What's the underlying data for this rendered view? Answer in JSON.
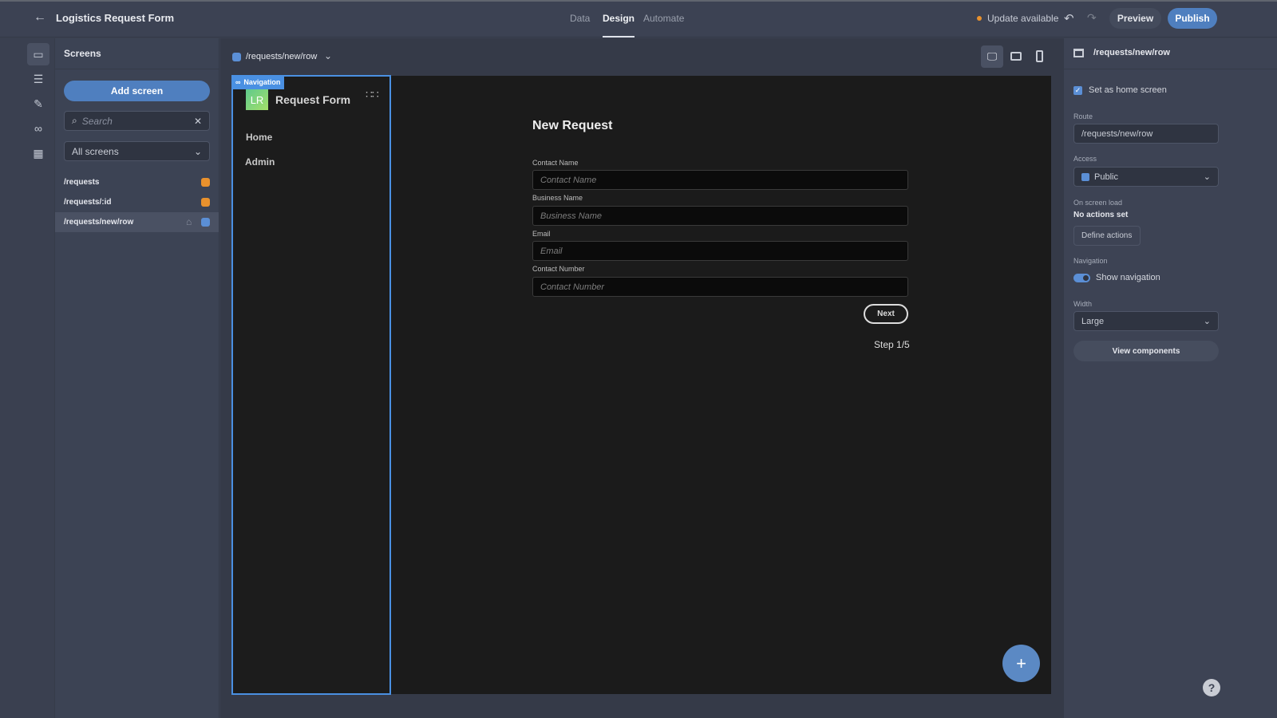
{
  "header": {
    "title": "Logistics Request Form",
    "tabs": [
      "Data",
      "Design",
      "Automate"
    ],
    "active_tab": "Design",
    "update": "Update available",
    "preview": "Preview",
    "publish": "Publish",
    "accent": "#4f7fbf"
  },
  "screens_panel": {
    "title": "Screens",
    "add_screen": "Add screen",
    "search_placeholder": "Search",
    "filter": "All screens",
    "items": [
      {
        "route": "/requests",
        "color": "#e8912d"
      },
      {
        "route": "/requests/:id",
        "color": "#e8912d"
      },
      {
        "route": "/requests/new/row",
        "color": "#5b8fd6",
        "home": true,
        "selected": true
      }
    ]
  },
  "canvas": {
    "route": "/requests/new/row",
    "nav_badge": "Navigation",
    "logo": "LR",
    "app_title": "Request Form",
    "nav_links": [
      "Home",
      "Admin"
    ],
    "form": {
      "title": "New Request",
      "fields": [
        {
          "label": "Contact Name",
          "placeholder": "Contact Name"
        },
        {
          "label": "Business Name",
          "placeholder": "Business Name"
        },
        {
          "label": "Email",
          "placeholder": "Email"
        },
        {
          "label": "Contact Number",
          "placeholder": "Contact Number"
        }
      ],
      "next": "Next",
      "step": "Step 1/5"
    },
    "add": "+"
  },
  "settings": {
    "route_title": "/requests/new/row",
    "home_screen": "Set as home screen",
    "home_checked": true,
    "route_label": "Route",
    "route_value": "/requests/new/row",
    "access_label": "Access",
    "access_value": "Public",
    "on_load_label": "On screen load",
    "no_actions": "No actions set",
    "define_actions": "Define actions",
    "navigation_label": "Navigation",
    "show_navigation": "Show navigation",
    "show_navigation_on": true,
    "width_label": "Width",
    "width_value": "Large",
    "view_components": "View components",
    "help": "?"
  }
}
